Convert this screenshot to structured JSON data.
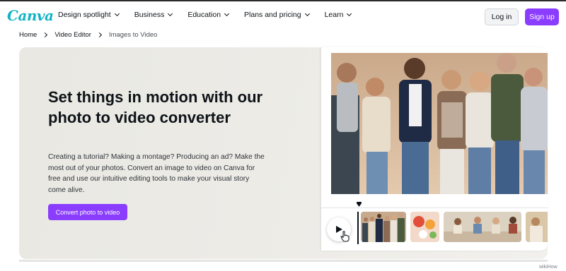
{
  "header": {
    "logo": "Canva",
    "nav": [
      {
        "label": "Design spotlight"
      },
      {
        "label": "Business"
      },
      {
        "label": "Education"
      },
      {
        "label": "Plans and pricing"
      },
      {
        "label": "Learn"
      }
    ],
    "login_label": "Log in",
    "signup_label": "Sign up"
  },
  "breadcrumb": [
    "Home",
    "Video Editor",
    "Images to Video"
  ],
  "hero": {
    "title": "Set things in motion with our photo to video converter",
    "description": "Creating a tutorial? Making a montage? Producing an ad? Make the most out of your photos. Convert an image to video on Canva for free and use our intuitive editing tools to make your visual story come alive.",
    "cta_label": "Convert photo to video"
  },
  "media": {
    "icons": [
      "play-icon",
      "pointer-hand-icon",
      "playhead-marker-icon"
    ]
  },
  "watermark": "wikiHow",
  "colors": {
    "brand_purple": "#8b3dff",
    "logo_teal": "#12b3c6",
    "hero_bg": "#ecebe6"
  }
}
